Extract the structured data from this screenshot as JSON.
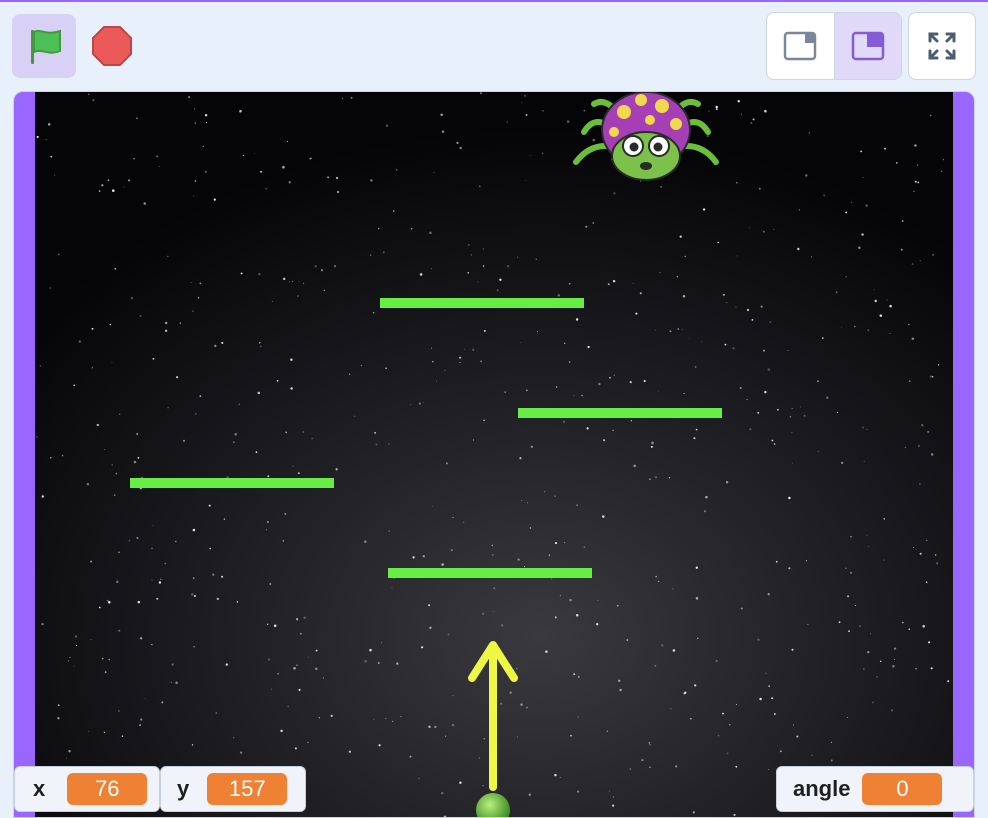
{
  "toolbar": {
    "green_flag_icon": "green-flag-icon",
    "stop_icon": "stop-sign-icon",
    "small_stage_icon": "small-stage-icon",
    "large_stage_icon": "large-stage-icon",
    "fullscreen_icon": "fullscreen-icon"
  },
  "colors": {
    "accent": "#9966ff",
    "platform": "#66ee44",
    "arrow": "#eef744",
    "monitor_value": "#ee8133"
  },
  "monitors": {
    "x": {
      "label": "x",
      "value": "76"
    },
    "y": {
      "label": "y",
      "value": "157"
    },
    "angle": {
      "label": "angle",
      "value": "0"
    }
  }
}
